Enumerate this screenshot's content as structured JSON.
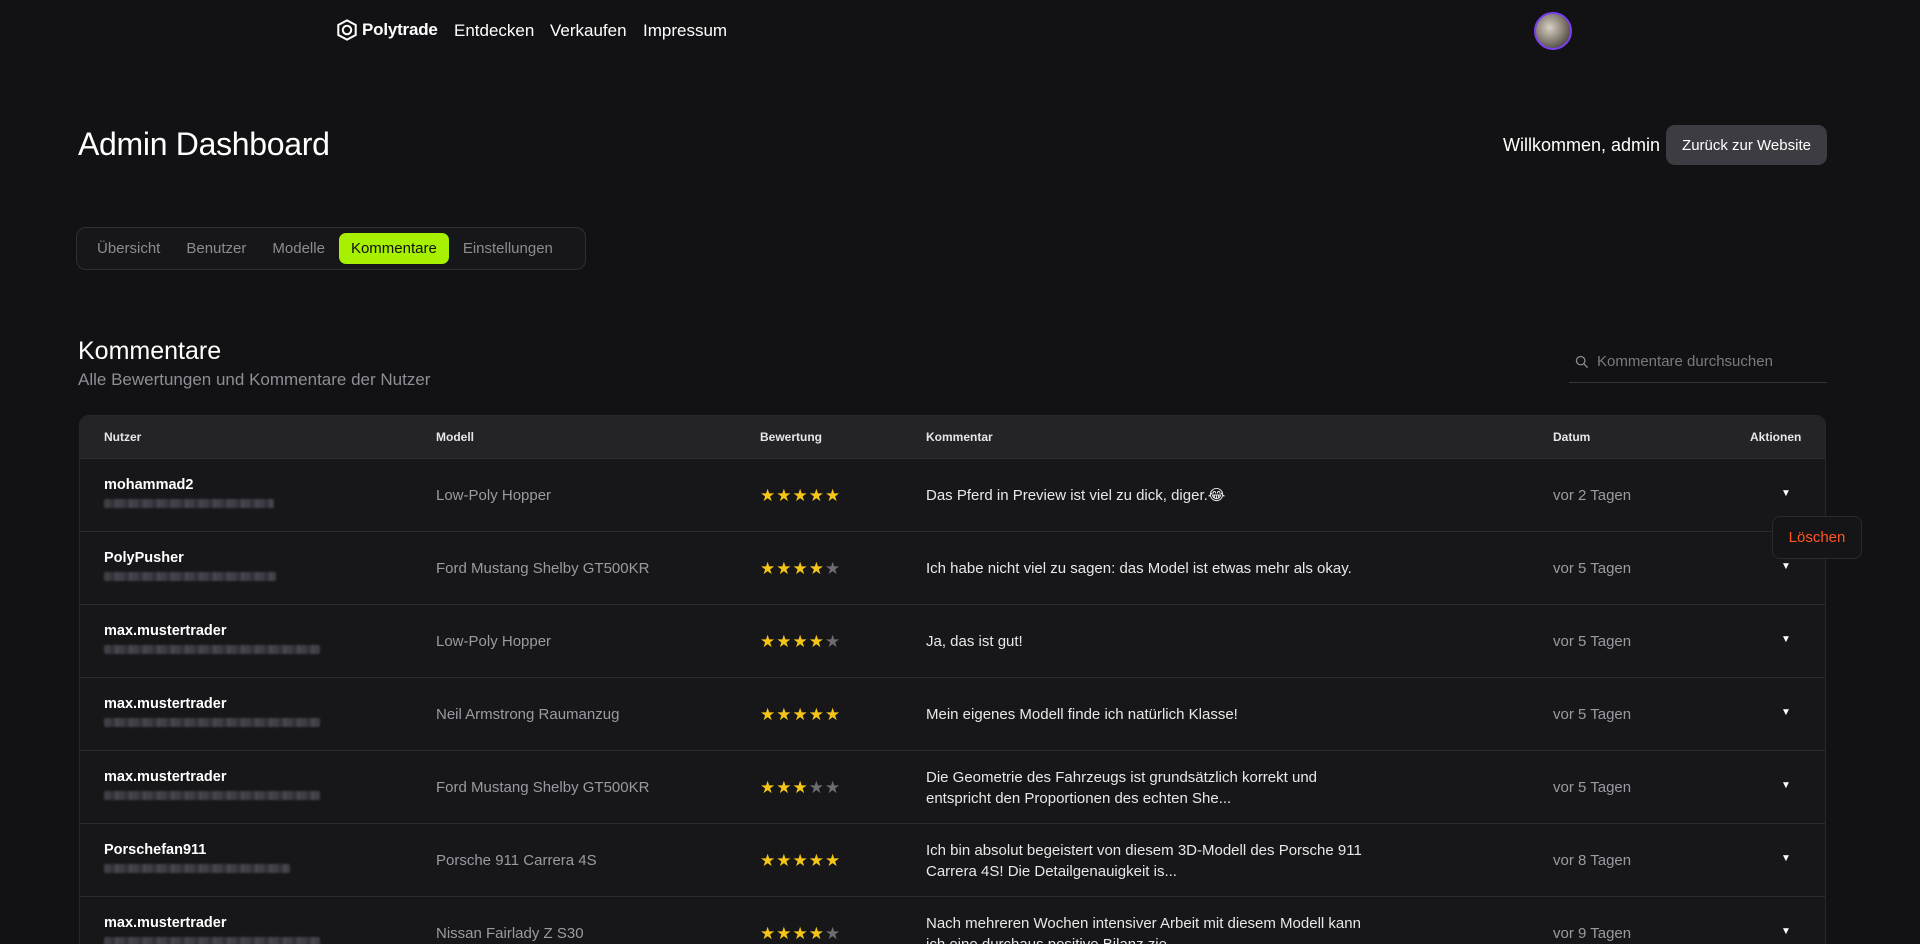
{
  "nav": {
    "brand": "Polytrade",
    "links": [
      "Entdecken",
      "Verkaufen",
      "Impressum"
    ]
  },
  "header": {
    "title": "Admin Dashboard",
    "welcome": "Willkommen, admin",
    "back_button": "Zurück zur Website"
  },
  "tabs": {
    "items": [
      "Übersicht",
      "Benutzer",
      "Modelle",
      "Kommentare",
      "Einstellungen"
    ],
    "active": "Kommentare"
  },
  "section": {
    "title": "Kommentare",
    "subtitle": "Alle Bewertungen und Kommentare der Nutzer",
    "search_placeholder": "Kommentare durchsuchen"
  },
  "table": {
    "headers": {
      "user": "Nutzer",
      "model": "Modell",
      "rating": "Bewertung",
      "comment": "Kommentar",
      "date": "Datum",
      "actions": "Aktionen"
    },
    "rows": [
      {
        "user": "mohammad2",
        "model": "Low-Poly Hopper",
        "rating": 5,
        "comment": "Das Pferd in Preview ist viel zu dick, diger.😂",
        "date": "vor 2 Tagen"
      },
      {
        "user": "PolyPusher",
        "model": "Ford Mustang Shelby GT500KR",
        "rating": 4,
        "comment": "Ich habe nicht viel zu sagen: das Model ist etwas mehr als okay.",
        "date": "vor 5 Tagen"
      },
      {
        "user": "max.mustertrader",
        "model": "Low-Poly Hopper",
        "rating": 4,
        "comment": "Ja, das ist gut!",
        "date": "vor 5 Tagen"
      },
      {
        "user": "max.mustertrader",
        "model": "Neil Armstrong Raumanzug",
        "rating": 5,
        "comment": "Mein eigenes Modell finde ich natürlich Klasse!",
        "date": "vor 5 Tagen"
      },
      {
        "user": "max.mustertrader",
        "model": "Ford Mustang Shelby GT500KR",
        "rating": 3,
        "comment": "Die Geometrie des Fahrzeugs ist grundsätzlich korrekt und entspricht den Proportionen des echten She...",
        "date": "vor 5 Tagen"
      },
      {
        "user": "Porschefan911",
        "model": "Porsche 911 Carrera 4S",
        "rating": 5,
        "comment": "Ich bin absolut begeistert von diesem 3D-Modell des Porsche 911 Carrera 4S! Die Detailgenauigkeit is...",
        "date": "vor 8 Tagen"
      },
      {
        "user": "max.mustertrader",
        "model": "Nissan Fairlady Z S30",
        "rating": 4,
        "comment": "Nach mehreren Wochen intensiver Arbeit mit diesem Modell kann ich eine durchaus positive Bilanz zie...",
        "date": "vor 9 Tagen"
      }
    ]
  },
  "popover": {
    "delete_label": "Löschen"
  },
  "colors": {
    "accent": "#a6f000",
    "star": "#f5c518",
    "danger": "#ff5722",
    "background": "#121214"
  }
}
